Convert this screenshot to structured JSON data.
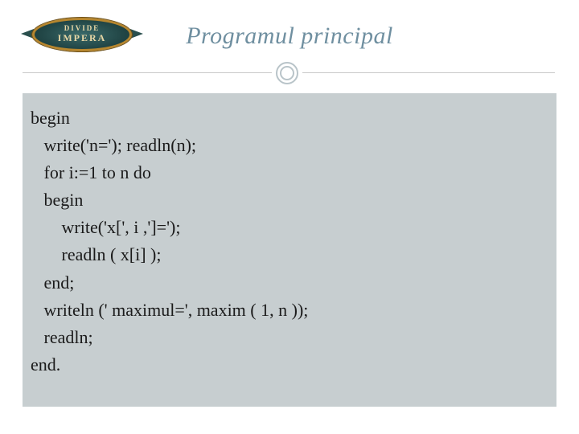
{
  "logo": {
    "line1": "DIVIDE",
    "line2": "IMPERA"
  },
  "title": "Programul principal",
  "code_lines": [
    "begin",
    "   write('n='); readln(n);",
    "   for i:=1 to n do",
    "   begin",
    "       write('x[', i ,']=');",
    "       readln ( x[i] );",
    "   end;",
    "   writeln (' maximul=', maxim ( 1, n ));",
    "   readln;",
    "end."
  ]
}
